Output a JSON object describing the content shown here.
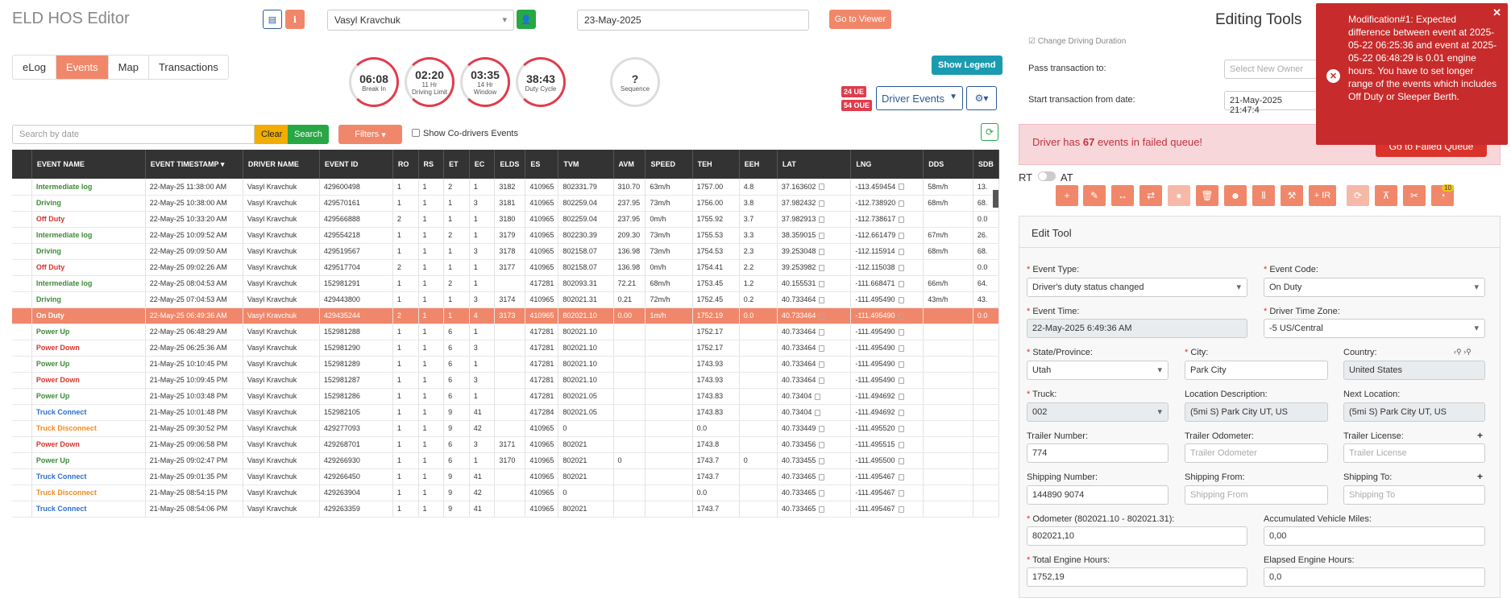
{
  "app": {
    "title": "ELD HOS Editor"
  },
  "header": {
    "driver": "Vasyl Kravchuk",
    "date": "23-May-2025",
    "go_to_viewer": "Go to Viewer"
  },
  "tabs": [
    "eLog",
    "Events",
    "Map",
    "Transactions"
  ],
  "gauges": [
    {
      "value": "06:08",
      "label": "Break In"
    },
    {
      "value": "02:20",
      "label": "11 Hr Driving Limit"
    },
    {
      "value": "03:35",
      "label": "14 Hr Window"
    },
    {
      "value": "38:43",
      "label": "Duty Cycle"
    },
    {
      "value": "?",
      "label": "Sequence"
    }
  ],
  "toolbar": {
    "show_legend": "Show Legend",
    "ue_badge": "24 UE",
    "oue_badge": "54 OUE",
    "driver_events": "Driver Events"
  },
  "search": {
    "placeholder": "Search by date",
    "clear": "Clear",
    "search": "Search",
    "filters": "Filters",
    "codrivers": "Show Co-drivers Events"
  },
  "table": {
    "headers": [
      "EVENT NAME",
      "EVENT TIMESTAMP",
      "DRIVER NAME",
      "EVENT ID",
      "RO",
      "RS",
      "ET",
      "EC",
      "ELDS",
      "ES",
      "TVM",
      "AVM",
      "SPEED",
      "TEH",
      "EEH",
      "LAT",
      "LNG",
      "DDS",
      "SDB"
    ],
    "rows": [
      {
        "name": "Intermediate log",
        "st": "green",
        "ts": "22-May-25 11:38:00 AM",
        "drv": "Vasyl Kravchuk",
        "id": "429600498",
        "ro": "1",
        "rs": "1",
        "et": "2",
        "ec": "1",
        "elds": "3182",
        "es": "410965",
        "tvm": "802331.79",
        "avm": "310.70",
        "spd": "63m/h",
        "teh": "1757.00",
        "eeh": "4.8",
        "lat": "37.163602",
        "lng": "-113.459454",
        "dds": "58m/h",
        "sdb": "13."
      },
      {
        "name": "Driving",
        "st": "green",
        "ts": "22-May-25 10:38:00 AM",
        "drv": "Vasyl Kravchuk",
        "id": "429570161",
        "ro": "1",
        "rs": "1",
        "et": "1",
        "ec": "3",
        "elds": "3181",
        "es": "410965",
        "tvm": "802259.04",
        "avm": "237.95",
        "spd": "73m/h",
        "teh": "1756.00",
        "eeh": "3.8",
        "lat": "37.982432",
        "lng": "-112.738920",
        "dds": "68m/h",
        "sdb": "68."
      },
      {
        "name": "Off Duty",
        "st": "red",
        "ts": "22-May-25 10:33:20 AM",
        "drv": "Vasyl Kravchuk",
        "id": "429566888",
        "ro": "2",
        "rs": "1",
        "et": "1",
        "ec": "1",
        "elds": "3180",
        "es": "410965",
        "tvm": "802259.04",
        "avm": "237.95",
        "spd": "0m/h",
        "teh": "1755.92",
        "eeh": "3.7",
        "lat": "37.982913",
        "lng": "-112.738617",
        "dds": "",
        "sdb": "0.0"
      },
      {
        "name": "Intermediate log",
        "st": "green",
        "ts": "22-May-25 10:09:52 AM",
        "drv": "Vasyl Kravchuk",
        "id": "429554218",
        "ro": "1",
        "rs": "1",
        "et": "2",
        "ec": "1",
        "elds": "3179",
        "es": "410965",
        "tvm": "802230.39",
        "avm": "209.30",
        "spd": "73m/h",
        "teh": "1755.53",
        "eeh": "3.3",
        "lat": "38.359015",
        "lng": "-112.661479",
        "dds": "67m/h",
        "sdb": "26."
      },
      {
        "name": "Driving",
        "st": "green",
        "ts": "22-May-25 09:09:50 AM",
        "drv": "Vasyl Kravchuk",
        "id": "429519567",
        "ro": "1",
        "rs": "1",
        "et": "1",
        "ec": "3",
        "elds": "3178",
        "es": "410965",
        "tvm": "802158.07",
        "avm": "136.98",
        "spd": "73m/h",
        "teh": "1754.53",
        "eeh": "2.3",
        "lat": "39.253048",
        "lng": "-112.115914",
        "dds": "68m/h",
        "sdb": "68."
      },
      {
        "name": "Off Duty",
        "st": "red",
        "ts": "22-May-25 09:02:26 AM",
        "drv": "Vasyl Kravchuk",
        "id": "429517704",
        "ro": "2",
        "rs": "1",
        "et": "1",
        "ec": "1",
        "elds": "3177",
        "es": "410965",
        "tvm": "802158.07",
        "avm": "136.98",
        "spd": "0m/h",
        "teh": "1754.41",
        "eeh": "2.2",
        "lat": "39.253982",
        "lng": "-112.115038",
        "dds": "",
        "sdb": "0.0"
      },
      {
        "name": "Intermediate log",
        "st": "green",
        "ts": "22-May-25 08:04:53 AM",
        "drv": "Vasyl Kravchuk",
        "id": "152981291",
        "ro": "1",
        "rs": "1",
        "et": "2",
        "ec": "1",
        "elds": "",
        "es": "417281",
        "tvm": "802093.31",
        "avm": "72.21",
        "spd": "68m/h",
        "teh": "1753.45",
        "eeh": "1.2",
        "lat": "40.155531",
        "lng": "-111.668471",
        "dds": "66m/h",
        "sdb": "64."
      },
      {
        "name": "Driving",
        "st": "green",
        "ts": "22-May-25 07:04:53 AM",
        "drv": "Vasyl Kravchuk",
        "id": "429443800",
        "ro": "1",
        "rs": "1",
        "et": "1",
        "ec": "3",
        "elds": "3174",
        "es": "410965",
        "tvm": "802021.31",
        "avm": "0.21",
        "spd": "72m/h",
        "teh": "1752.45",
        "eeh": "0.2",
        "lat": "40.733464",
        "lng": "-111.495490",
        "dds": "43m/h",
        "sdb": "43."
      },
      {
        "name": "On Duty",
        "st": "white",
        "sel": true,
        "ts": "22-May-25 06:49:36 AM",
        "drv": "Vasyl Kravchuk",
        "id": "429435244",
        "ro": "2",
        "rs": "1",
        "et": "1",
        "ec": "4",
        "elds": "3173",
        "es": "410965",
        "tvm": "802021.10",
        "avm": "0.00",
        "spd": "1m/h",
        "teh": "1752.19",
        "eeh": "0.0",
        "lat": "40.733464",
        "lng": "-111.495490",
        "dds": "",
        "sdb": "0.0"
      },
      {
        "name": "Power Up",
        "st": "green",
        "ts": "22-May-25 06:48:29 AM",
        "drv": "Vasyl Kravchuk",
        "id": "152981288",
        "ro": "1",
        "rs": "1",
        "et": "6",
        "ec": "1",
        "elds": "",
        "es": "417281",
        "tvm": "802021.10",
        "avm": "",
        "spd": "",
        "teh": "1752.17",
        "eeh": "",
        "lat": "40.733464",
        "lng": "-111.495490",
        "dds": "",
        "sdb": ""
      },
      {
        "name": "Power Down",
        "st": "red",
        "ts": "22-May-25 06:25:36 AM",
        "drv": "Vasyl Kravchuk",
        "id": "152981290",
        "ro": "1",
        "rs": "1",
        "et": "6",
        "ec": "3",
        "elds": "",
        "es": "417281",
        "tvm": "802021.10",
        "avm": "",
        "spd": "",
        "teh": "1752.17",
        "eeh": "",
        "lat": "40.733464",
        "lng": "-111.495490",
        "dds": "",
        "sdb": ""
      },
      {
        "name": "Power Up",
        "st": "green",
        "ts": "21-May-25 10:10:45 PM",
        "drv": "Vasyl Kravchuk",
        "id": "152981289",
        "ro": "1",
        "rs": "1",
        "et": "6",
        "ec": "1",
        "elds": "",
        "es": "417281",
        "tvm": "802021.10",
        "avm": "",
        "spd": "",
        "teh": "1743.93",
        "eeh": "",
        "lat": "40.733464",
        "lng": "-111.495490",
        "dds": "",
        "sdb": ""
      },
      {
        "name": "Power Down",
        "st": "red",
        "ts": "21-May-25 10:09:45 PM",
        "drv": "Vasyl Kravchuk",
        "id": "152981287",
        "ro": "1",
        "rs": "1",
        "et": "6",
        "ec": "3",
        "elds": "",
        "es": "417281",
        "tvm": "802021.10",
        "avm": "",
        "spd": "",
        "teh": "1743.93",
        "eeh": "",
        "lat": "40.733464",
        "lng": "-111.495490",
        "dds": "",
        "sdb": ""
      },
      {
        "name": "Power Up",
        "st": "green",
        "ts": "21-May-25 10:03:48 PM",
        "drv": "Vasyl Kravchuk",
        "id": "152981286",
        "ro": "1",
        "rs": "1",
        "et": "6",
        "ec": "1",
        "elds": "",
        "es": "417281",
        "tvm": "802021.05",
        "avm": "",
        "spd": "",
        "teh": "1743.83",
        "eeh": "",
        "lat": "40.73404",
        "lng": "-111.494692",
        "dds": "",
        "sdb": ""
      },
      {
        "name": "Truck Connect",
        "st": "blue",
        "ts": "21-May-25 10:01:48 PM",
        "drv": "Vasyl Kravchuk",
        "id": "152982105",
        "ro": "1",
        "rs": "1",
        "et": "9",
        "ec": "41",
        "elds": "",
        "es": "417284",
        "tvm": "802021.05",
        "avm": "",
        "spd": "",
        "teh": "1743.83",
        "eeh": "",
        "lat": "40.73404",
        "lng": "-111.494692",
        "dds": "",
        "sdb": ""
      },
      {
        "name": "Truck Disconnect",
        "st": "orange",
        "ts": "21-May-25 09:30:52 PM",
        "drv": "Vasyl Kravchuk",
        "id": "429277093",
        "ro": "1",
        "rs": "1",
        "et": "9",
        "ec": "42",
        "elds": "",
        "es": "410965",
        "tvm": "0",
        "avm": "",
        "spd": "",
        "teh": "0.0",
        "eeh": "",
        "lat": "40.733449",
        "lng": "-111.495520",
        "dds": "",
        "sdb": ""
      },
      {
        "name": "Power Down",
        "st": "red",
        "ts": "21-May-25 09:06:58 PM",
        "drv": "Vasyl Kravchuk",
        "id": "429268701",
        "ro": "1",
        "rs": "1",
        "et": "6",
        "ec": "3",
        "elds": "3171",
        "es": "410965",
        "tvm": "802021",
        "avm": "",
        "spd": "",
        "teh": "1743.8",
        "eeh": "",
        "lat": "40.733456",
        "lng": "-111.495515",
        "dds": "",
        "sdb": ""
      },
      {
        "name": "Power Up",
        "st": "green",
        "ts": "21-May-25 09:02:47 PM",
        "drv": "Vasyl Kravchuk",
        "id": "429266930",
        "ro": "1",
        "rs": "1",
        "et": "6",
        "ec": "1",
        "elds": "3170",
        "es": "410965",
        "tvm": "802021",
        "avm": "0",
        "spd": "",
        "teh": "1743.7",
        "eeh": "0",
        "lat": "40.733455",
        "lng": "-111.495500",
        "dds": "",
        "sdb": ""
      },
      {
        "name": "Truck Connect",
        "st": "blue",
        "ts": "21-May-25 09:01:35 PM",
        "drv": "Vasyl Kravchuk",
        "id": "429266450",
        "ro": "1",
        "rs": "1",
        "et": "9",
        "ec": "41",
        "elds": "",
        "es": "410965",
        "tvm": "802021",
        "avm": "",
        "spd": "",
        "teh": "1743.7",
        "eeh": "",
        "lat": "40.733465",
        "lng": "-111.495467",
        "dds": "",
        "sdb": ""
      },
      {
        "name": "Truck Disconnect",
        "st": "orange",
        "ts": "21-May-25 08:54:15 PM",
        "drv": "Vasyl Kravchuk",
        "id": "429263904",
        "ro": "1",
        "rs": "1",
        "et": "9",
        "ec": "42",
        "elds": "",
        "es": "410965",
        "tvm": "0",
        "avm": "",
        "spd": "",
        "teh": "0.0",
        "eeh": "",
        "lat": "40.733465",
        "lng": "-111.495467",
        "dds": "",
        "sdb": ""
      },
      {
        "name": "Truck Connect",
        "st": "blue",
        "ts": "21-May-25 08:54:06 PM",
        "drv": "Vasyl Kravchuk",
        "id": "429263359",
        "ro": "1",
        "rs": "1",
        "et": "9",
        "ec": "41",
        "elds": "",
        "es": "410965",
        "tvm": "802021",
        "avm": "",
        "spd": "",
        "teh": "1743.7",
        "eeh": "",
        "lat": "40.733465",
        "lng": "-111.495467",
        "dds": "",
        "sdb": ""
      }
    ]
  },
  "right": {
    "title": "Editing Tools",
    "change_driving": "Change Driving Duration",
    "pass_transaction": "Pass transaction to:",
    "select_owner": "Select New Owner",
    "start_from": "Start transaction from date:",
    "start_value": "21-May-2025 21:47:4",
    "failed_prefix": "Driver has ",
    "failed_count": "67",
    "failed_suffix": " events in failed queue!",
    "go_failed": "Go to Failed Queue",
    "rt": "RT",
    "at": "AT",
    "ir": "+ IR",
    "tool_badge": "10",
    "edit_tool": "Edit Tool"
  },
  "form": {
    "event_type_label": "Event Type:",
    "event_type": "Driver's duty status changed",
    "event_code_label": "Event Code:",
    "event_code": "On Duty",
    "event_time_label": "Event Time:",
    "event_time": "22-May-2025 6:49:36 AM",
    "tz_label": "Driver Time Zone:",
    "tz": "-5 US/Central",
    "state_label": "State/Province:",
    "state": "Utah",
    "city_label": "City:",
    "city": "Park City",
    "country_label": "Country:",
    "country": "United States",
    "truck_label": "Truck:",
    "truck": "002",
    "loc_desc_label": "Location Description:",
    "loc_desc": "(5mi S) Park City UT, US",
    "next_loc_label": "Next Location:",
    "next_loc": "(5mi S) Park City UT, US",
    "trailer_num_label": "Trailer Number:",
    "trailer_num": "774",
    "trailer_odo_label": "Trailer Odometer:",
    "trailer_odo_ph": "Trailer Odometer",
    "trailer_lic_label": "Trailer License:",
    "trailer_lic_ph": "Trailer License",
    "ship_num_label": "Shipping Number:",
    "ship_num": "144890 9074",
    "ship_from_label": "Shipping From:",
    "ship_from_ph": "Shipping From",
    "ship_to_label": "Shipping To:",
    "ship_to_ph": "Shipping To",
    "odometer_label": "Odometer (802021.10 - 802021.31):",
    "odometer": "802021,10",
    "acc_miles_label": "Accumulated Vehicle Miles:",
    "acc_miles": "0,00",
    "teh_label": "Total Engine Hours:",
    "teh": "1752,19",
    "eeh_label": "Elapsed Engine Hours:",
    "eeh": "0,0"
  },
  "toast": {
    "text": "Modification#1: Expected difference between event at 2025-05-22 06:25:36 and event at 2025-05-22 06:48:29 is 0.01 engine hours. You have to set longer range of the events which includes Off Duty or Sleeper Berth."
  }
}
